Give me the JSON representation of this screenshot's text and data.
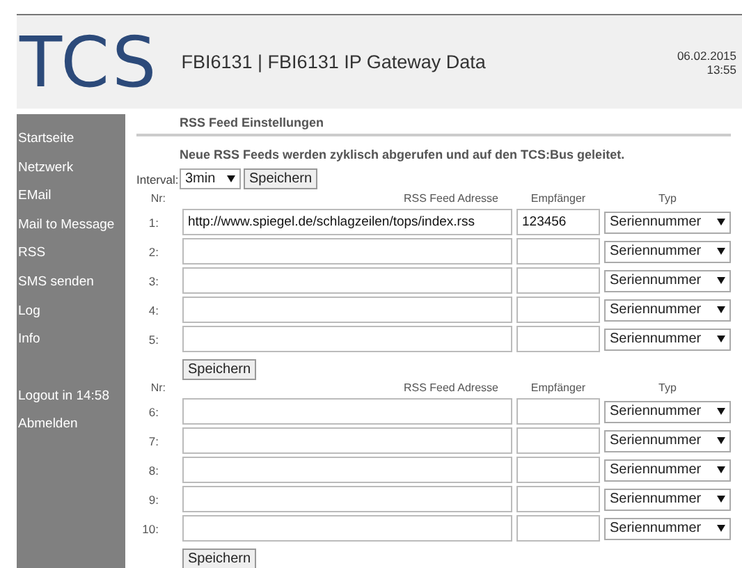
{
  "header": {
    "logo": "TCS",
    "title": "FBI6131 | FBI6131 IP Gateway Data",
    "date": "06.02.2015",
    "time": "13:55"
  },
  "sidebar": {
    "items": [
      {
        "label": "Startseite"
      },
      {
        "label": "Netzwerk"
      },
      {
        "label": "EMail"
      },
      {
        "label": "Mail to Message"
      },
      {
        "label": "RSS"
      },
      {
        "label": "SMS senden"
      },
      {
        "label": "Log"
      },
      {
        "label": "Info"
      }
    ],
    "footer_items": [
      {
        "label": "Logout in 14:58"
      },
      {
        "label": "Abmelden"
      }
    ]
  },
  "content": {
    "title": "RSS Feed Einstellungen",
    "description": "Neue RSS Feeds werden zyklisch abgerufen und auf den TCS:Bus geleitet.",
    "interval": {
      "label": "Interval:",
      "value": "3min",
      "button": "Speichern"
    },
    "groups": [
      {
        "columns": [
          "Nr:",
          "RSS Feed Adresse",
          "Empfänger",
          "Typ"
        ],
        "rows": [
          {
            "number": "1:",
            "url": "http://www.spiegel.de/schlagzeilen/tops/index.rss",
            "recipient": "123456",
            "type": "Seriennummer"
          },
          {
            "number": "2:",
            "type": "Seriennummer"
          },
          {
            "number": "3:",
            "type": "Seriennummer"
          },
          {
            "number": "4:",
            "type": "Seriennummer"
          },
          {
            "number": "5:",
            "type": "Seriennummer"
          }
        ],
        "button": "Speichern"
      },
      {
        "columns": [
          "Nr:",
          "RSS Feed Adresse",
          "Empfänger",
          "Typ"
        ],
        "rows": [
          {
            "number": "6:",
            "type": "Seriennummer"
          },
          {
            "number": "7:",
            "type": "Seriennummer"
          },
          {
            "number": "8:",
            "type": "Seriennummer"
          },
          {
            "number": "9:",
            "type": "Seriennummer"
          },
          {
            "number": "10:",
            "type": "Seriennummer"
          }
        ],
        "button": "Speichern"
      }
    ]
  }
}
